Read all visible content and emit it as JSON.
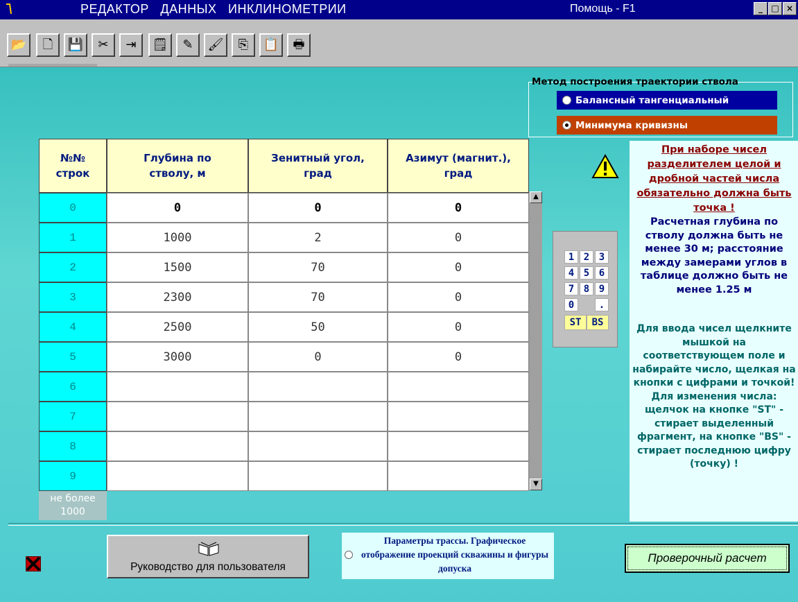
{
  "window": {
    "title": "РЕДАКТОР   ДАННЫХ   ИНКЛИНОМЕТРИИ",
    "help": "Помощь - F1",
    "minimize": "_",
    "maximize": "□",
    "close": "×"
  },
  "toolbar": {
    "buttons": [
      {
        "name": "open-icon",
        "glyph": "📂"
      },
      {
        "name": "new-file-icon",
        "glyph": "🗋"
      },
      {
        "name": "save-icon",
        "glyph": "💾"
      },
      {
        "name": "cut-icon",
        "glyph": "✂"
      },
      {
        "name": "import-icon",
        "glyph": "⇥"
      },
      {
        "name": "properties-icon",
        "glyph": "🗒"
      },
      {
        "name": "edit-icon",
        "glyph": "✎"
      },
      {
        "name": "brush-icon",
        "glyph": "🖌"
      },
      {
        "name": "copy-icon",
        "glyph": "⎘"
      },
      {
        "name": "paste-icon",
        "glyph": "📋"
      },
      {
        "name": "print-icon",
        "glyph": "🖶"
      }
    ]
  },
  "method": {
    "legend": "Метод построения траектории ствола",
    "options": [
      {
        "label": "Балансный тангенциальный",
        "color": "#0000a0",
        "selected": false
      },
      {
        "label": "Минимума кривизны",
        "color": "#c04000",
        "selected": true
      }
    ]
  },
  "table": {
    "headers": [
      "№№\nстрок",
      "Глубина по\nстволу, м",
      "Зенитный угол,\nград",
      "Азимут (магнит.),\nград"
    ],
    "rows": [
      {
        "num": "0",
        "depth": "0",
        "zenith": "0",
        "azimuth": "0"
      },
      {
        "num": "1",
        "depth": "1000",
        "zenith": "2",
        "azimuth": "0"
      },
      {
        "num": "2",
        "depth": "1500",
        "zenith": "70",
        "azimuth": "0"
      },
      {
        "num": "3",
        "depth": "2300",
        "zenith": "70",
        "azimuth": "0"
      },
      {
        "num": "4",
        "depth": "2500",
        "zenith": "50",
        "azimuth": "0"
      },
      {
        "num": "5",
        "depth": "3000",
        "zenith": "0",
        "azimuth": "0"
      },
      {
        "num": "6",
        "depth": "",
        "zenith": "",
        "azimuth": ""
      },
      {
        "num": "7",
        "depth": "",
        "zenith": "",
        "azimuth": ""
      },
      {
        "num": "8",
        "depth": "",
        "zenith": "",
        "azimuth": ""
      },
      {
        "num": "9",
        "depth": "",
        "zenith": "",
        "azimuth": ""
      }
    ],
    "limit": "не более\n1000"
  },
  "keypad": {
    "keys": [
      "1",
      "2",
      "3",
      "4",
      "5",
      "6",
      "7",
      "8",
      "9",
      "0",
      "",
      "."
    ],
    "st": "ST",
    "bs": "BS"
  },
  "hints": {
    "decimal": "При наборе чисел разделителем целой и дробной частей числа обязательно должна быть точка !",
    "depth": "Расчетная глубина по стволу должна быть не менее 30 м; расстояние между замерами углов в таблице должно быть не менее 1.25 м",
    "input": "Для ввода чисел щелкните мышкой на соответствующем поле и набирайте число, щелкая на кнопки с цифрами и точкой! Для изменения числа: щелчок на кнопке \"ST\" - стирает выделенный фрагмент, на кнопке \"BS\" - стирает последнюю цифру (точку) !"
  },
  "bottom": {
    "manual": "Руководство для пользователя",
    "params": "Параметры трассы. Графическое отображение проекций скважины и фигуры допуска",
    "verify": "Проверочный расчет"
  }
}
